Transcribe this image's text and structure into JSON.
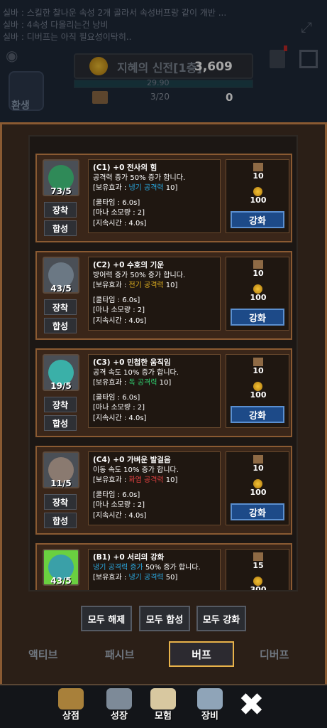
{
  "chat": [
    "실바 : 스킬한 찰나운 속성 2개 골라서 속성버프랑 같이 개반 ...",
    "실바 : 4속성 다올리는건 낭비",
    "실바 : 디버프는 아직 필요성이탁히.."
  ],
  "hero": {
    "label": "환생"
  },
  "header": {
    "title": "지혜의 신전[1층]",
    "gold": "3,609",
    "exp_text": "29.90",
    "scroll_text": "3/20",
    "scroll_value": "0"
  },
  "labels": {
    "equip": "장착",
    "merge": "합성",
    "upgrade": "강화"
  },
  "cards": [
    {
      "count": "73/5",
      "icon_color": "#2f8a58",
      "name": "(C1) +0 전사의 힘",
      "line1": "공격력 증가 50% 증가 합니다.",
      "retain_pre": "[보유효과 : ",
      "retain_hl": "냉기 공격력",
      "retain_post": " 10]",
      "hl_class": "hl-cyan",
      "cooldown": "[쿨타임 : 6.0s]",
      "mana": "[마나 소모량 : 2]",
      "duration": "[지속시간 : 4.0s]",
      "cost_scroll": "10",
      "cost_gold": "100"
    },
    {
      "count": "43/5",
      "icon_color": "#6b7884",
      "name": "(C2) +0 수호의 기운",
      "line1": "방어력 증가 50% 증가 합니다.",
      "retain_pre": "[보유효과 : ",
      "retain_hl": "전기 공격력",
      "retain_post": " 10]",
      "hl_class": "hl-yellow",
      "cooldown": "[쿨타임 : 6.0s]",
      "mana": "[마나 소모량 : 2]",
      "duration": "[지속시간 : 4.0s]",
      "cost_scroll": "10",
      "cost_gold": "100"
    },
    {
      "count": "19/5",
      "icon_color": "#3ab0a8",
      "name": "(C3) +0 민첩한 움직임",
      "line1": "공격 속도 10% 증가 합니다.",
      "retain_pre": "[보유효과 : ",
      "retain_hl": "독 공격력",
      "retain_post": " 10]",
      "hl_class": "hl-green",
      "cooldown": "[쿨타임 : 6.0s]",
      "mana": "[마나 소모량 : 2]",
      "duration": "[지속시간 : 4.0s]",
      "cost_scroll": "10",
      "cost_gold": "100"
    },
    {
      "count": "11/5",
      "icon_color": "#8a7a70",
      "name": "(C4) +0 가벼운 발걸음",
      "line1": "이동 속도 10% 증가 합니다.",
      "retain_pre": "[보유효과 : ",
      "retain_hl": "화염 공격력",
      "retain_post": " 10]",
      "hl_class": "hl-red",
      "cooldown": "[쿨타임 : 6.0s]",
      "mana": "[마나 소모량 : 2]",
      "duration": "[지속시간 : 4.0s]",
      "cost_scroll": "10",
      "cost_gold": "100"
    },
    {
      "count": "43/5",
      "icon_color": "#3aa0a8",
      "name": "(B1) +0 서리의 강화",
      "line1_hl": "냉기 공격력 증가",
      "line1_post": " 50% 증가 합니다.",
      "retain_pre": "[보유효과 : ",
      "retain_hl": "냉기 공격력",
      "retain_post": " 50]",
      "hl_class": "hl-cyan",
      "cost_scroll": "15",
      "cost_gold": "300"
    }
  ],
  "bulk_buttons": {
    "release_all": "모두 해제",
    "merge_all": "모두 합성",
    "upgrade_all": "모두 강화"
  },
  "tabs": {
    "active_skill": "액티브",
    "passive": "패시브",
    "buff": "버프",
    "debuff": "디버프"
  },
  "bottom_nav": {
    "shop": "상점",
    "growth": "성장",
    "adventure": "모험",
    "equipment": "장비"
  }
}
